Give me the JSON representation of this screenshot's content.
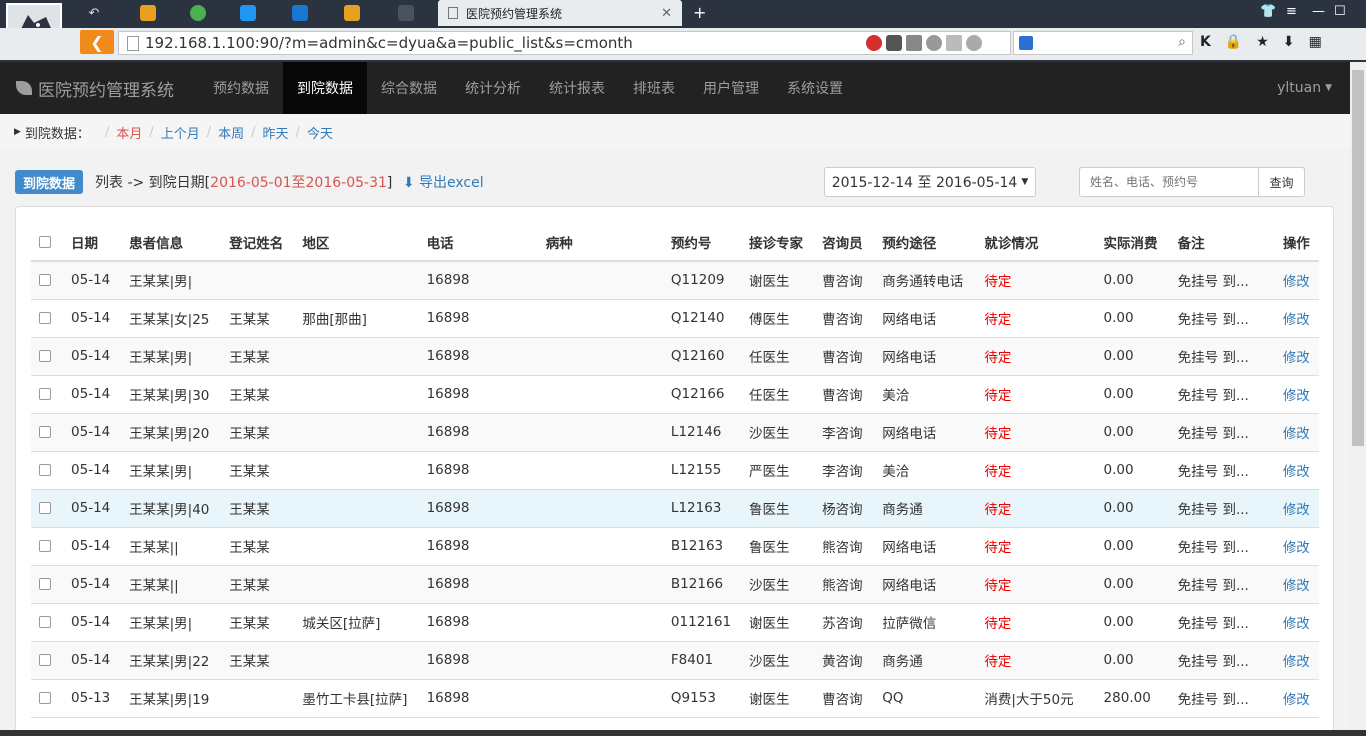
{
  "browser": {
    "tab_title": "医院预约管理系统",
    "url": "192.168.1.100:90/?m=admin&c=dyua&a=public_list&s=cmonth"
  },
  "nav": {
    "brand": "医院预约管理系统",
    "items": [
      "预约数据",
      "到院数据",
      "综合数据",
      "统计分析",
      "统计报表",
      "排班表",
      "用户管理",
      "系统设置"
    ],
    "user": "yltuan"
  },
  "crumbs": {
    "label": "到院数据：",
    "links": [
      "本月",
      "上个月",
      "本周",
      "昨天",
      "今天"
    ]
  },
  "toolbar": {
    "badge": "到院数据",
    "list_prefix": "列表 -> 到院日期[",
    "date_range": "2016-05-01至2016-05-31",
    "list_suffix": "]",
    "export": "导出excel",
    "date_picker": "2015-12-14 至 2016-05-14",
    "search_placeholder": "姓名、电话、预约号",
    "search_button": "查询"
  },
  "table": {
    "headers": [
      "日期",
      "患者信息",
      "登记姓名",
      "地区",
      "电话",
      "病种",
      "预约号",
      "接诊专家",
      "咨询员",
      "预约途径",
      "就诊情况",
      "实际消费",
      "备注",
      "操作"
    ],
    "rows": [
      [
        "05-14",
        "王某某|男|",
        "",
        "",
        "16898",
        "",
        "Q11209",
        "谢医生",
        "曹咨询",
        "商务通转电话",
        "待定",
        "0.00",
        "免挂号 到...",
        "修改"
      ],
      [
        "05-14",
        "王某某|女|25",
        "王某某",
        "那曲[那曲]",
        "16898",
        "",
        "Q12140",
        "傅医生",
        "曹咨询",
        "网络电话",
        "待定",
        "0.00",
        "免挂号 到...",
        "修改"
      ],
      [
        "05-14",
        "王某某|男|",
        "王某某",
        "",
        "16898",
        "",
        "Q12160",
        "任医生",
        "曹咨询",
        "网络电话",
        "待定",
        "0.00",
        "免挂号 到...",
        "修改"
      ],
      [
        "05-14",
        "王某某|男|30",
        "王某某",
        "",
        "16898",
        "",
        "Q12166",
        "任医生",
        "曹咨询",
        "美洽",
        "待定",
        "0.00",
        "免挂号 到...",
        "修改"
      ],
      [
        "05-14",
        "王某某|男|20",
        "王某某",
        "",
        "16898",
        "",
        "L12146",
        "沙医生",
        "李咨询",
        "网络电话",
        "待定",
        "0.00",
        "免挂号 到...",
        "修改"
      ],
      [
        "05-14",
        "王某某|男|",
        "王某某",
        "",
        "16898",
        "",
        "L12155",
        "严医生",
        "李咨询",
        "美洽",
        "待定",
        "0.00",
        "免挂号 到...",
        "修改"
      ],
      [
        "05-14",
        "王某某|男|40",
        "王某某",
        "",
        "16898",
        "",
        "L12163",
        "鲁医生",
        "杨咨询",
        "商务通",
        "待定",
        "0.00",
        "免挂号 到...",
        "修改"
      ],
      [
        "05-14",
        "王某某||",
        "王某某",
        "",
        "16898",
        "",
        "B12163",
        "鲁医生",
        "熊咨询",
        "网络电话",
        "待定",
        "0.00",
        "免挂号 到...",
        "修改"
      ],
      [
        "05-14",
        "王某某||",
        "王某某",
        "",
        "16898",
        "",
        "B12166",
        "沙医生",
        "熊咨询",
        "网络电话",
        "待定",
        "0.00",
        "免挂号 到...",
        "修改"
      ],
      [
        "05-14",
        "王某某|男|",
        "王某某",
        "城关区[拉萨]",
        "16898",
        "",
        "0112161",
        "谢医生",
        "苏咨询",
        "拉萨微信",
        "待定",
        "0.00",
        "免挂号 到...",
        "修改"
      ],
      [
        "05-14",
        "王某某|男|22",
        "王某某",
        "",
        "16898",
        "",
        "F8401",
        "沙医生",
        "黄咨询",
        "商务通",
        "待定",
        "0.00",
        "免挂号 到...",
        "修改"
      ],
      [
        "05-13",
        "王某某|男|19",
        "",
        "墨竹工卡县[拉萨]",
        "16898",
        "",
        "Q9153",
        "谢医生",
        "曹咨询",
        "QQ",
        "消费|大于50元",
        "280.00",
        "免挂号 到...",
        "修改"
      ]
    ]
  }
}
